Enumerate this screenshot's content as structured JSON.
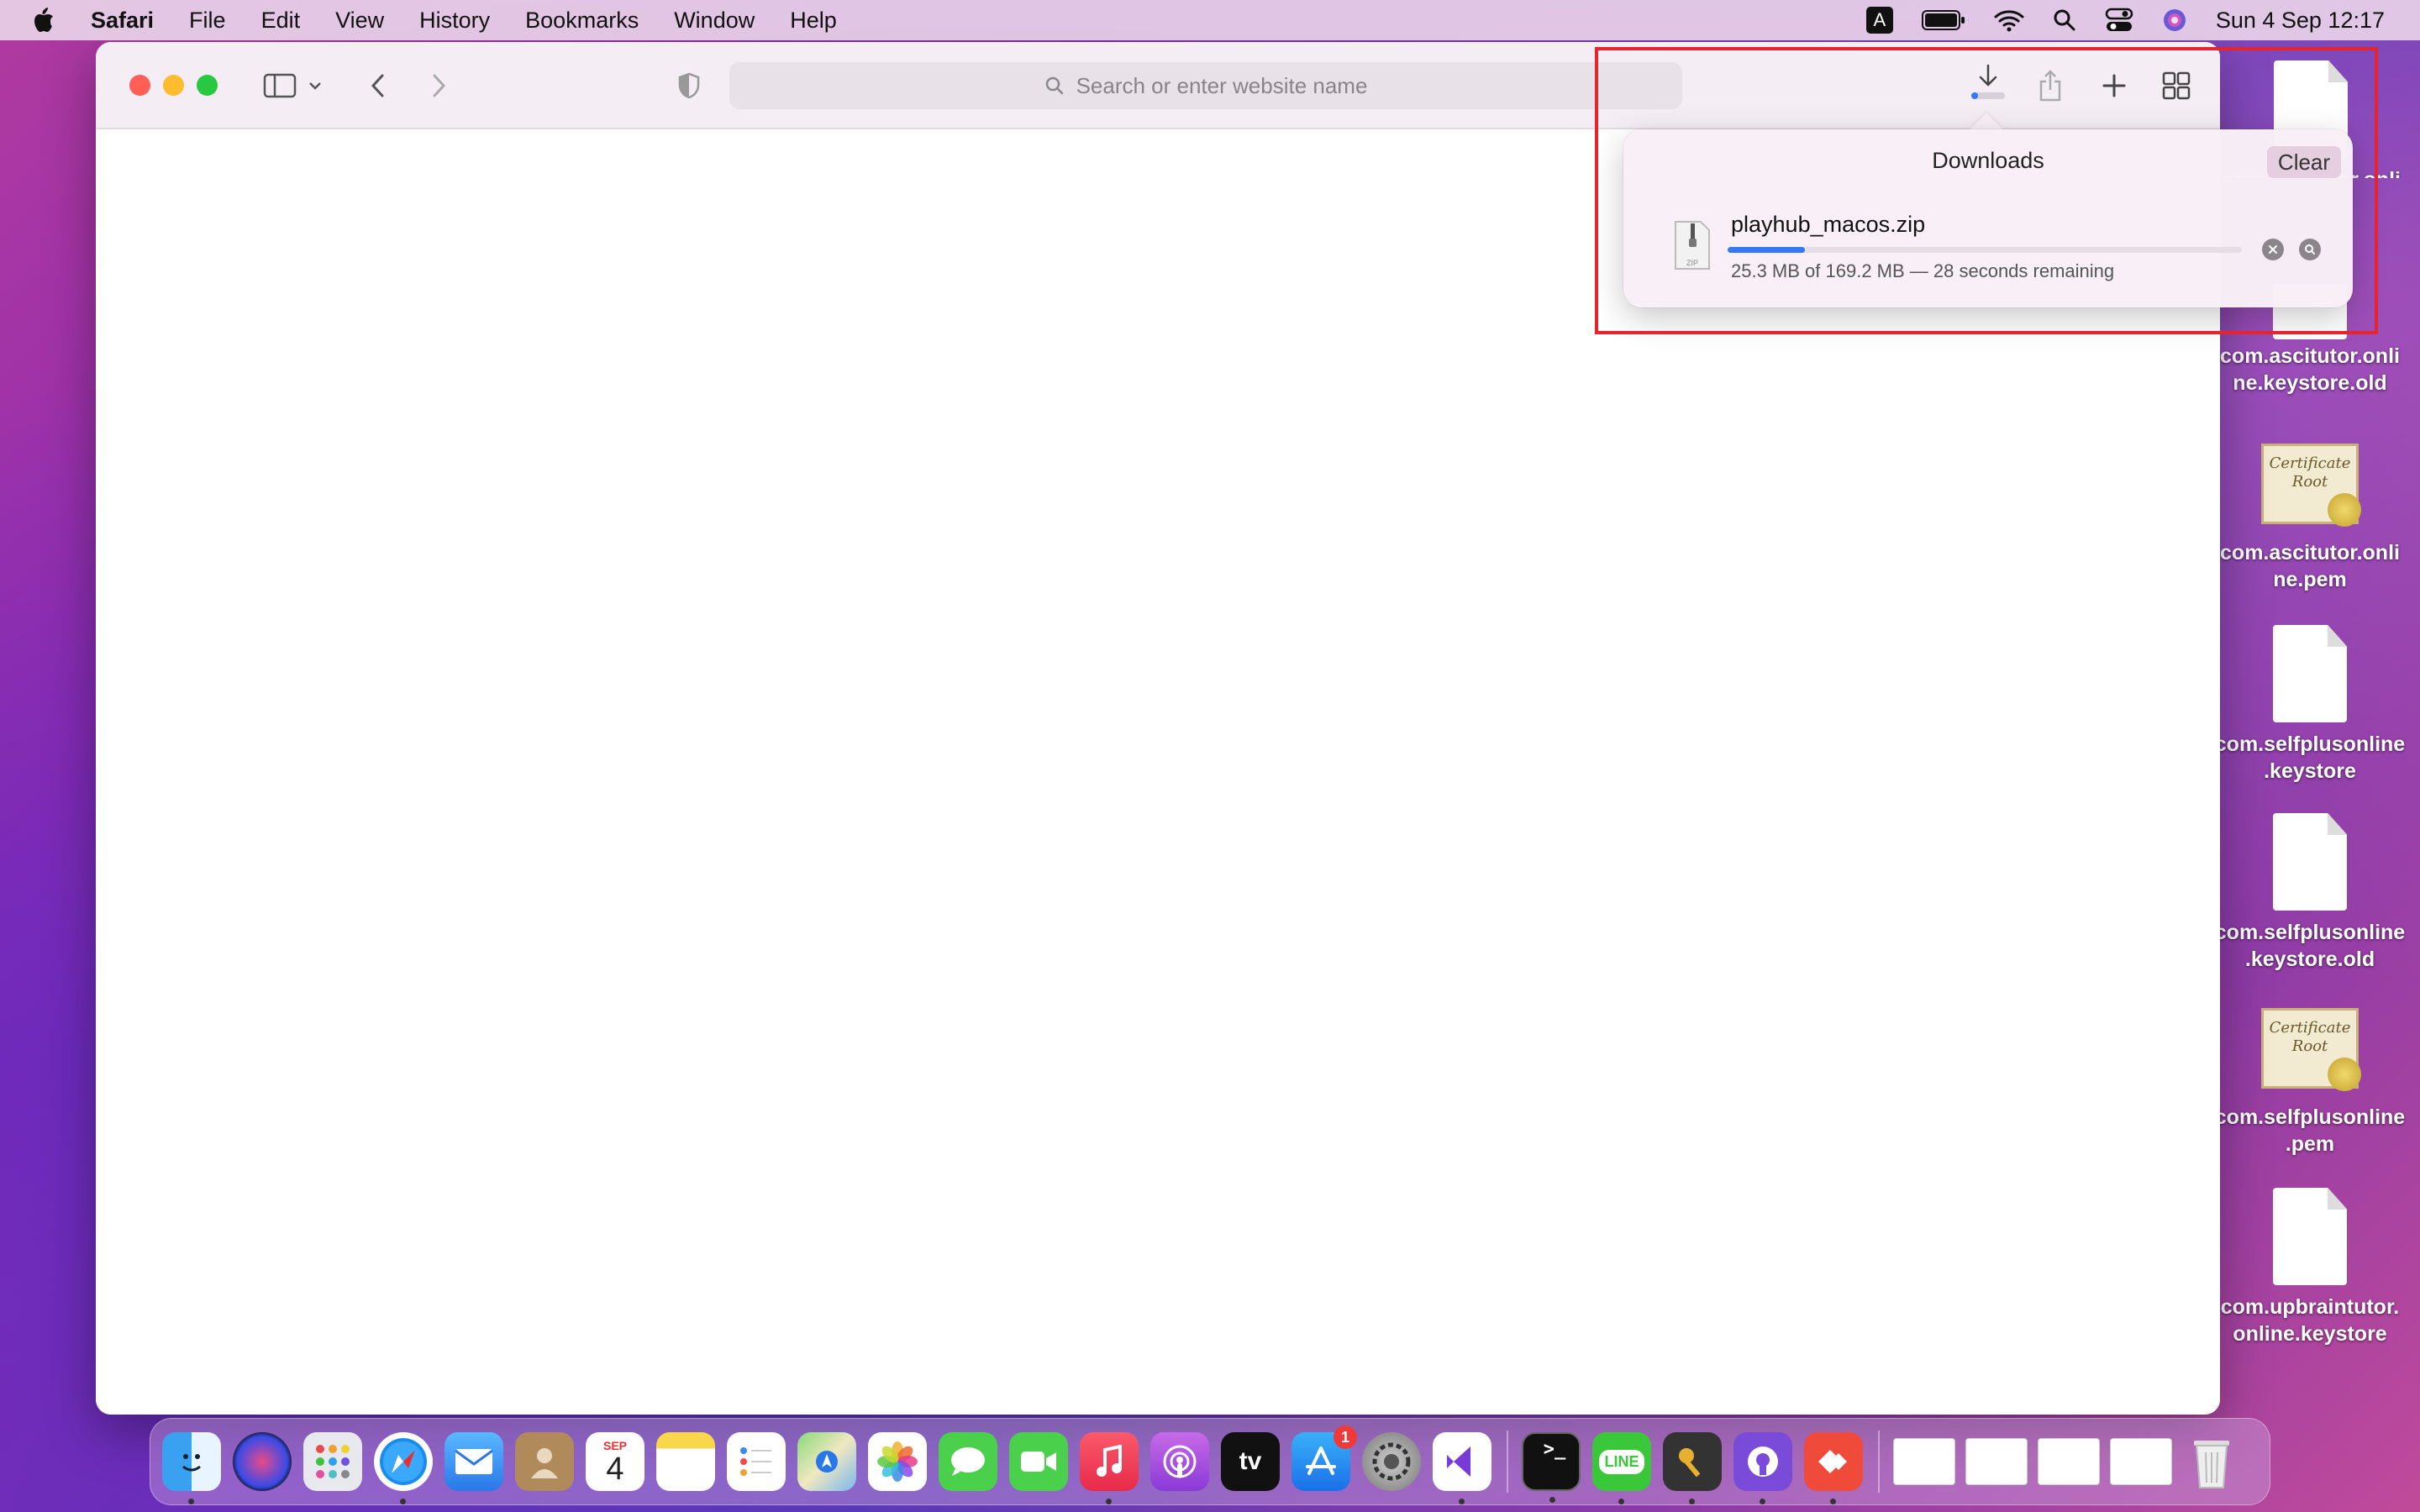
{
  "menubar": {
    "app_name": "Safari",
    "items": [
      "File",
      "Edit",
      "View",
      "History",
      "Bookmarks",
      "Window",
      "Help"
    ],
    "input_source": "A",
    "clock": "Sun 4 Sep  12:17"
  },
  "browser": {
    "address_placeholder": "Search or enter website name"
  },
  "downloads": {
    "title": "Downloads",
    "clear_label": "Clear",
    "file_name": "playhub_macos.zip",
    "file_icon_label": "ZIP",
    "status": "25.3 MB of 169.2 MB — 28 seconds remaining",
    "progress": 0.15
  },
  "desktop": {
    "icons": [
      {
        "label": "com.ascitutor.onli ne.keystore",
        "kind": "document"
      },
      {
        "label": "com.ascitutor.onli ne.keystore.old",
        "kind": "document"
      },
      {
        "label": "com.ascitutor.onli ne.pem",
        "kind": "certificate"
      },
      {
        "label": "com.selfplusonline .keystore",
        "kind": "document"
      },
      {
        "label": "com.selfplusonline .keystore.old",
        "kind": "document"
      },
      {
        "label": "com.selfplusonline .pem",
        "kind": "certificate"
      },
      {
        "label": "com.upbraintutor. online.keystore",
        "kind": "document"
      }
    ],
    "certificate_art": "Certificate Root"
  },
  "dock": {
    "calendar_month": "SEP",
    "calendar_day": "4",
    "appstore_badge": "1",
    "tv_label": "tv",
    "line_label": "LINE",
    "terminal_label": ">_"
  },
  "colors": {
    "accent": "#3478f6",
    "highlight_box": "#e5242f",
    "close": "#ff5f57",
    "minimize": "#febc2e",
    "zoom": "#28c840"
  }
}
